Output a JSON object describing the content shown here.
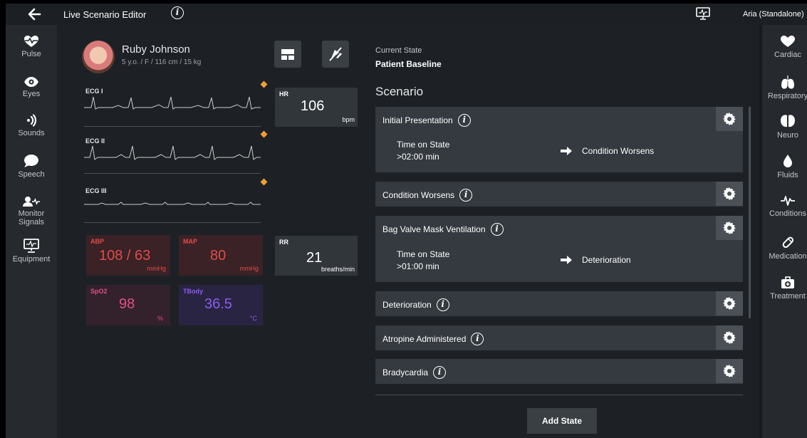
{
  "topbar": {
    "title": "Live Scenario Editor",
    "user": "Aria (Standalone)"
  },
  "leftnav": [
    {
      "label": "Pulse",
      "icon": "heartbeat-icon"
    },
    {
      "label": "Eyes",
      "icon": "eye-icon"
    },
    {
      "label": "Sounds",
      "icon": "sound-waves-icon"
    },
    {
      "label": "Speech",
      "icon": "speech-bubble-icon"
    },
    {
      "label": "Monitor Signals",
      "icon": "person-vitals-icon"
    },
    {
      "label": "Equipment",
      "icon": "monitor-icon"
    }
  ],
  "rightnav": [
    {
      "label": "Cardiac",
      "icon": "heart-icon"
    },
    {
      "label": "Respiratory",
      "icon": "lungs-icon"
    },
    {
      "label": "Neuro",
      "icon": "brain-icon"
    },
    {
      "label": "Fluids",
      "icon": "drop-icon"
    },
    {
      "label": "Conditions",
      "icon": "pulse-line-icon"
    },
    {
      "label": "Medication",
      "icon": "pill-icon"
    },
    {
      "label": "Treatment",
      "icon": "first-aid-icon"
    }
  ],
  "patient": {
    "name": "Ruby Johnson",
    "info": "5 y.o. / F / 116 cm / 15 kg"
  },
  "waves": {
    "ecg1": "ECG I",
    "ecg2": "ECG II",
    "ecg3": "ECG III"
  },
  "vitals": {
    "hr": {
      "label": "HR",
      "value": "106",
      "unit": "bpm"
    },
    "abp": {
      "label": "ABP",
      "value": "108 / 63",
      "unit": "mmHg"
    },
    "map": {
      "label": "MAP",
      "value": "80",
      "unit": "mmHg"
    },
    "rr": {
      "label": "RR",
      "value": "21",
      "unit": "breaths/min"
    },
    "spo2": {
      "label": "SpO2",
      "value": "98",
      "unit": "%"
    },
    "tbody": {
      "label": "TBody",
      "value": "36.5",
      "unit": "°C"
    }
  },
  "current_state": {
    "label": "Current State",
    "value": "Patient Baseline"
  },
  "scenario": {
    "title": "Scenario",
    "time_label": "Time on State",
    "states": [
      {
        "name": "Initial Presentation",
        "time": ">02:00 min",
        "next": "Condition Worsens"
      },
      {
        "name": "Condition Worsens"
      },
      {
        "name": "Bag Valve Mask Ventilation",
        "time": ">01:00 min",
        "next": "Deterioration"
      },
      {
        "name": "Deterioration"
      },
      {
        "name": "Atropine Administered"
      },
      {
        "name": "Bradycardia"
      }
    ],
    "add_label": "Add State"
  },
  "colors": {
    "accent_orange": "#f0a030",
    "abp_red": "#e24b4b",
    "spo2_pink": "#e0508a",
    "tbody_purple": "#8a5cf0"
  }
}
